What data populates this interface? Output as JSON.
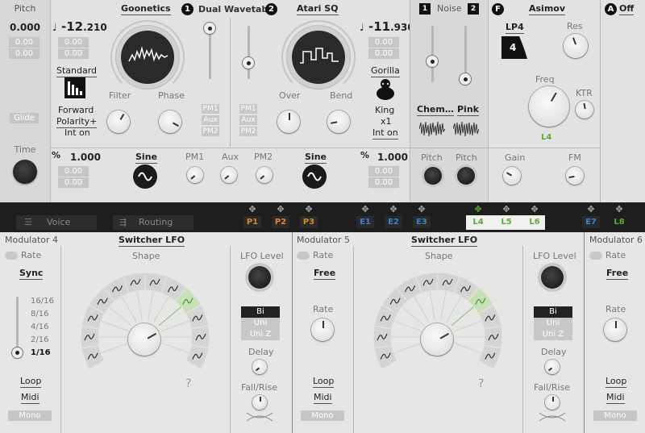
{
  "pitch": {
    "title": "Pitch",
    "value": "0.000",
    "sub1": "0.00",
    "sub2": "0.00",
    "glide": "Glide",
    "time": "Time"
  },
  "osc1": {
    "name": "Goonetics",
    "badge": "1",
    "note_icon": "♩",
    "value": "-12",
    "value_frac": ".210",
    "sub1": "0.00",
    "sub2": "0.00",
    "mode": "Standard",
    "l1": "Forward",
    "l2": "Polarity+",
    "l3": "Int on",
    "filter": "Filter",
    "phase": "Phase",
    "pct": "%",
    "level": "1.000",
    "lsub1": "0.00",
    "lsub2": "0.00",
    "shape": "Sine",
    "pm1": "PM1",
    "aux": "Aux",
    "pm2": "PM2"
  },
  "center": {
    "title": "Dual Wavetable",
    "pm1": "PM1",
    "aux": "Aux",
    "pm2": "PM2"
  },
  "osc2": {
    "name": "Atari SQ",
    "badge": "2",
    "note_icon": "♩",
    "value": "-11",
    "value_frac": ".930",
    "sub1": "0.00",
    "sub2": "0.00",
    "mode": "Gorilla",
    "l1": "King",
    "l2": "x1",
    "l3": "Int on",
    "over": "Over",
    "bend": "Bend",
    "pct": "%",
    "level": "1.000",
    "lsub1": "0.00",
    "lsub2": "0.00",
    "shape": "Sine"
  },
  "noise": {
    "badge1": "1",
    "title": "Noise",
    "badge2": "2",
    "src1": "Chem…",
    "src2": "Pink",
    "pitch1": "Pitch",
    "pitch2": "Pitch"
  },
  "filter": {
    "badge": "F",
    "name": "Asimov",
    "type": "LP4",
    "slope": "4",
    "res": "Res",
    "freq": "Freq",
    "ktr": "KTR",
    "layer": "L4",
    "gain": "Gain",
    "fm": "FM"
  },
  "amp": {
    "badge": "A",
    "state": "Off"
  },
  "tabs": {
    "voice": "Voice",
    "routing": "Routing"
  },
  "mod_tags": [
    {
      "label": "P1",
      "color": "#d9892a"
    },
    {
      "label": "P2",
      "color": "#d9892a"
    },
    {
      "label": "P3",
      "color": "#d9892a"
    },
    {
      "label": "E1",
      "color": "#3c7fd0"
    },
    {
      "label": "E2",
      "color": "#3c7fd0"
    },
    {
      "label": "E3",
      "color": "#3c7fd0"
    },
    {
      "label": "L4",
      "color": "#5aaa3a"
    },
    {
      "label": "L5",
      "color": "#5aaa3a"
    },
    {
      "label": "L6",
      "color": "#5aaa3a"
    },
    {
      "label": "E7",
      "color": "#3c7fd0"
    },
    {
      "label": "L8",
      "color": "#5aaa3a"
    }
  ],
  "mod4": {
    "title": "Modulator 4",
    "type": "Switcher LFO",
    "rate": "Rate",
    "sync": "Sync",
    "divs": [
      "16/16",
      "8/16",
      "4/16",
      "2/16",
      "1/16"
    ],
    "loop": "Loop",
    "midi": "Midi",
    "mono": "Mono",
    "shape": "Shape",
    "lfo_level": "LFO Level",
    "bi": "Bi",
    "uni": "Uni",
    "uniz": "Uni Z",
    "delay": "Delay",
    "fall": "Fall/Rise",
    "q": "?"
  },
  "mod5": {
    "title": "Modulator 5",
    "type": "Switcher LFO",
    "rate": "Rate",
    "sync": "Free",
    "rate2": "Rate",
    "loop": "Loop",
    "midi": "Midi",
    "mono": "Mono",
    "shape": "Shape",
    "lfo_level": "LFO Level",
    "bi": "Bi",
    "uni": "Uni",
    "uniz": "Uni Z",
    "delay": "Delay",
    "fall": "Fall/Rise",
    "q": "?"
  },
  "mod6": {
    "title": "Modulator 6",
    "rate": "Rate",
    "sync": "Free",
    "rate2": "Rate",
    "loop": "Loop",
    "midi": "Midi",
    "mono": "Mono"
  },
  "colors": {
    "accent_green": "#5aaa3a",
    "orange": "#d9892a",
    "blue": "#3c7fd0"
  }
}
